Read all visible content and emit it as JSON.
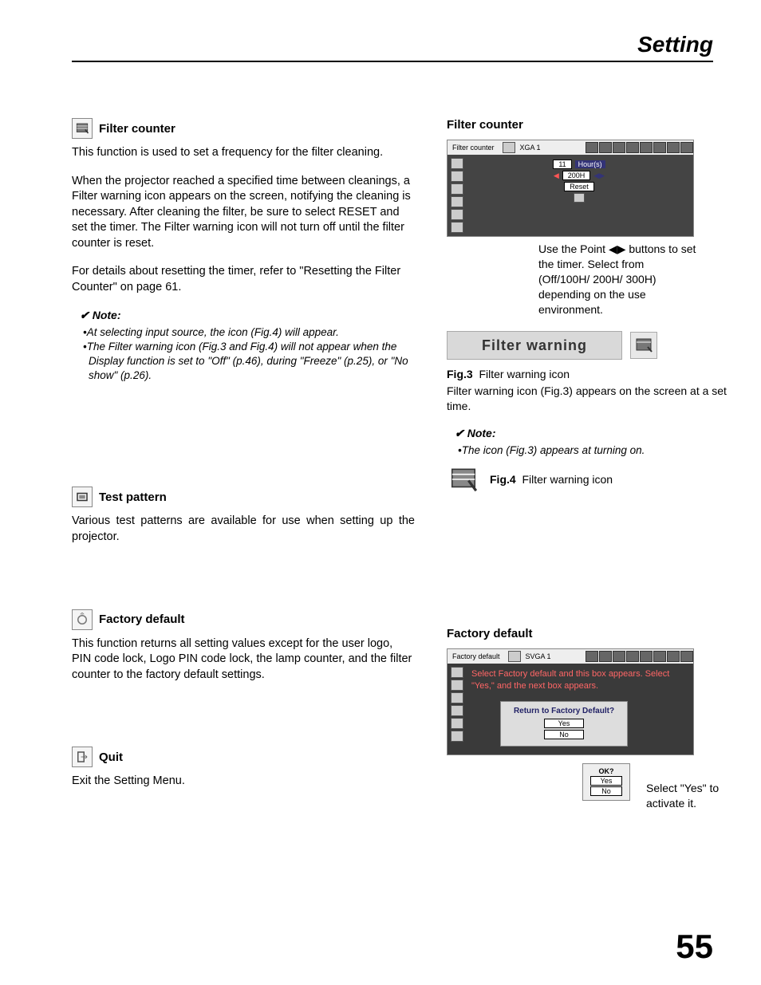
{
  "header": {
    "title": "Setting"
  },
  "left": {
    "filter_counter": {
      "title": "Filter counter",
      "p1": "This function is used to set a frequency for the filter cleaning.",
      "p2": "When the projector reached a specified time between cleanings, a Filter warning icon appears on the screen, notifying the cleaning is necessary. After cleaning the filter, be sure to select RESET and set the timer. The Filter warning icon will not turn off until the filter counter is reset.",
      "p3": "For details about resetting the timer, refer to \"Resetting the Filter Counter\" on page 61.",
      "note_label": "Note:",
      "notes": [
        "At selecting input source, the icon (Fig.4) will appear.",
        "The Filter warning icon (Fig.3 and Fig.4) will not appear when the Display function is set to \"Off\" (p.46), during \"Freeze\" (p.25), or \"No show\" (p.26)."
      ]
    },
    "test_pattern": {
      "title": "Test pattern",
      "p1": "Various test patterns are available for use when setting up the projector."
    },
    "factory_default": {
      "title": "Factory default",
      "p1": "This function returns all setting values except for the user logo, PIN code lock, Logo PIN code lock, the lamp counter, and the filter counter to the factory default settings."
    },
    "quit": {
      "title": "Quit",
      "p1": "Exit the Setting Menu."
    }
  },
  "right": {
    "filter_counter": {
      "title": "Filter counter",
      "screenshot": {
        "titlebar_label": "Filter counter",
        "mode": "XGA 1",
        "value": "11",
        "unit": "Hour(s)",
        "option": "200H",
        "reset": "Reset"
      },
      "caption": "Use the Point ◀▶ buttons to set the timer. Select from (Off/100H/ 200H/ 300H) depending on the use environment.",
      "banner": "Filter warning",
      "fig3_label": "Fig.3",
      "fig3_text": "Filter warning icon",
      "fig3_desc": "Filter warning icon (Fig.3) appears on the screen at a set time.",
      "note_label": "Note:",
      "note1": "The icon (Fig.3) appears at turning on.",
      "fig4_label": "Fig.4",
      "fig4_text": "Filter warning icon"
    },
    "factory_default": {
      "title": "Factory default",
      "screenshot": {
        "titlebar_label": "Factory default",
        "mode": "SVGA 1"
      },
      "instruction": "Select Factory default and this box appears.  Select \"Yes,\" and the next box appears.",
      "confirm1_title": "Return to Factory Default?",
      "yes": "Yes",
      "no": "No",
      "confirm2_title": "OK?",
      "caption2": "Select \"Yes\" to activate it."
    }
  },
  "page_number": "55"
}
